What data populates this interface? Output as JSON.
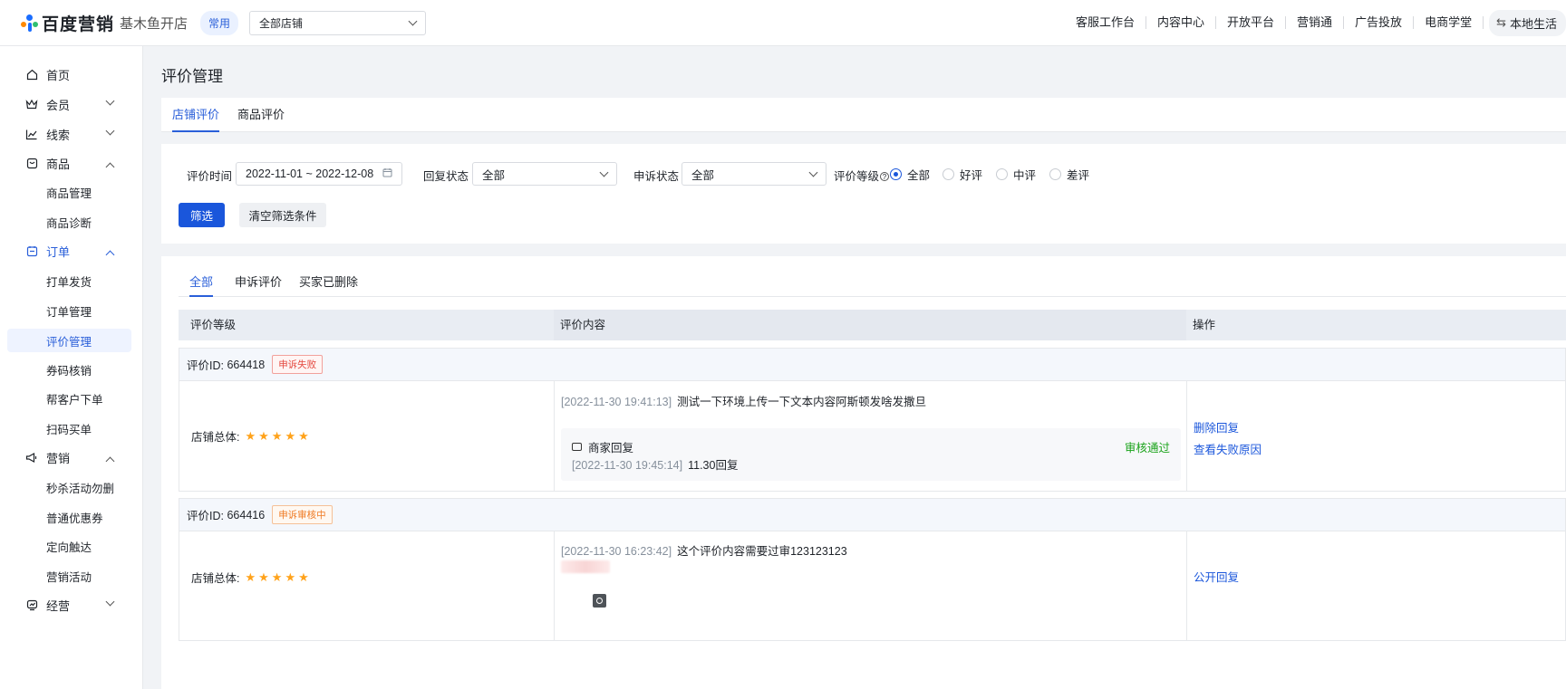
{
  "topbar": {
    "logo_text": "百度营销",
    "store_name": "基木鱼开店",
    "common_tag": "常用",
    "store_select": "全部店铺",
    "nav": [
      "客服工作台",
      "内容中心",
      "开放平台",
      "营销通",
      "广告投放",
      "电商学堂"
    ],
    "local_life": "本地生活"
  },
  "sidebar": {
    "home": "首页",
    "member": "会员",
    "leads": "线索",
    "product": "商品",
    "product_manage": "商品管理",
    "product_diag": "商品诊断",
    "order": "订单",
    "print_ship": "打单发货",
    "order_manage": "订单管理",
    "review_manage": "评价管理",
    "coupon_verify": "券码核销",
    "help_order": "帮客户下单",
    "scan_buy": "扫码买单",
    "marketing": "营销",
    "flash_sale": "秒杀活动勿删",
    "normal_coupon": "普通优惠券",
    "targeted_reach": "定向触达",
    "marketing_activity": "营销活动",
    "operation": "经营"
  },
  "page": {
    "title": "评价管理",
    "tabs": [
      "店铺评价",
      "商品评价"
    ]
  },
  "filters": {
    "time_label": "评价时间",
    "time_value": "2022-11-01 ~ 2022-12-08",
    "reply_label": "回复状态",
    "reply_value": "全部",
    "appeal_label": "申诉状态",
    "appeal_value": "全部",
    "level_label": "评价等级",
    "levels": [
      "全部",
      "好评",
      "中评",
      "差评"
    ],
    "level_selected": "全部",
    "filter_btn": "筛选",
    "clear_btn": "清空筛选条件"
  },
  "list": {
    "subtabs": [
      "全部",
      "申诉评价",
      "买家已删除"
    ],
    "headers": [
      "评价等级",
      "评价内容",
      "操作"
    ],
    "reviews": [
      {
        "id_label": "评价ID:",
        "id": "664418",
        "badge": "申诉失败",
        "store_label": "店铺总体:",
        "stars": "★★★★★",
        "time": "[2022-11-30 19:41:13]",
        "content": "测试一下环境上传一下文本内容阿斯顿发啥发撒旦",
        "reply_title": "商家回复",
        "reply_status": "审核通过",
        "reply_time": "[2022-11-30 19:45:14]",
        "reply_content": "11.30回复",
        "ops": [
          "删除回复",
          "查看失败原因"
        ]
      },
      {
        "id_label": "评价ID:",
        "id": "664416",
        "badge": "申诉审核中",
        "store_label": "店铺总体:",
        "stars": "★★★★★",
        "time": "[2022-11-30 16:23:42]",
        "content": "这个评价内容需要过审123123123",
        "ops": [
          "公开回复"
        ]
      }
    ]
  },
  "colors": {
    "primary": "#1a56db",
    "accent_text": "#2a5fd9",
    "star": "#ffa21a",
    "success": "#1aa31a"
  }
}
